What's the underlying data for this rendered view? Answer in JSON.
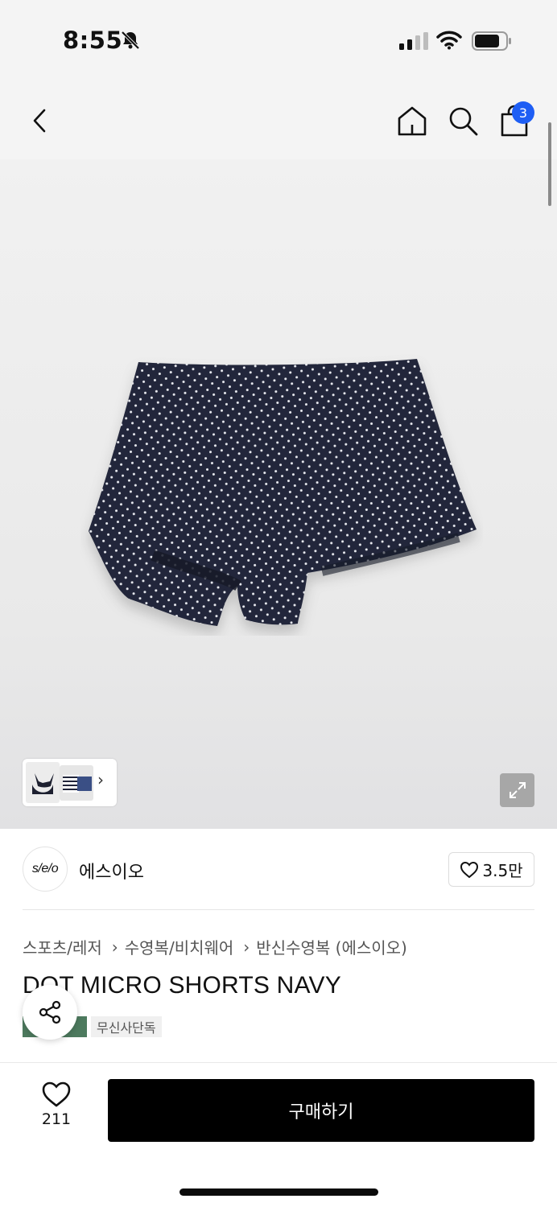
{
  "status_bar": {
    "time": "8:55",
    "icons": [
      "bell-slash-icon",
      "cellular-signal-icon",
      "wifi-icon",
      "battery-icon"
    ]
  },
  "header": {
    "icons": [
      "chevron-left-icon",
      "home-icon",
      "search-icon",
      "shopping-bag-icon"
    ],
    "cart_count": "3",
    "badge_color": "#1e5ef4"
  },
  "gallery": {
    "image": "navy polka dot shorts",
    "thumbnails_more_icon": "chevron-right-icon",
    "expand_icon": "expand-icon"
  },
  "brand": {
    "logo_text": "s/e/o",
    "name": "에스이오",
    "likes": "3.5만"
  },
  "breadcrumb": [
    "스포츠/레저",
    "수영복/비치웨어",
    "반신수영복 (에스이오)"
  ],
  "product": {
    "title": "DOT MICRO SHORTS NAVY",
    "tags": [
      {
        "label": "",
        "color": "#4d7a5e"
      },
      {
        "label": "무신사단독"
      }
    ]
  },
  "bottom_bar": {
    "wish_count": "211",
    "buy_label": "구매하기"
  }
}
